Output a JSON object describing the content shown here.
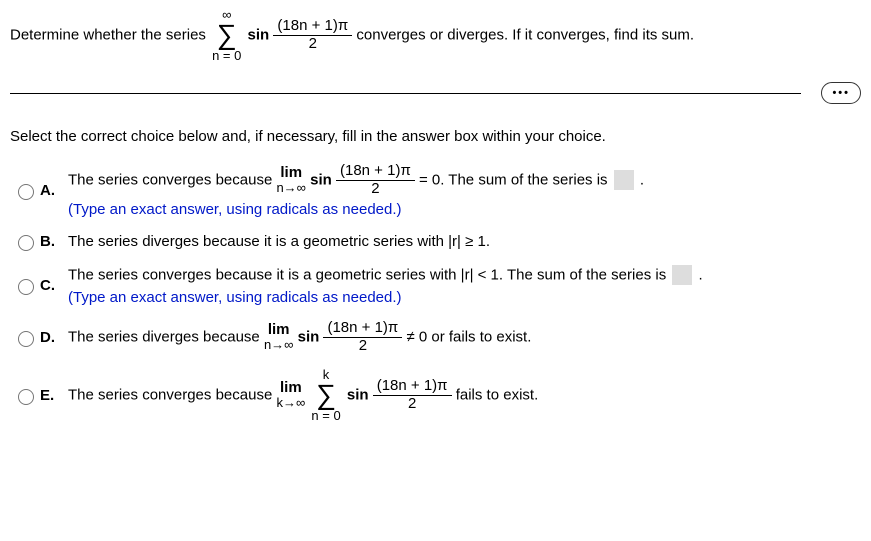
{
  "question": {
    "part1": "Determine whether the series ",
    "sigma_top": "∞",
    "sigma_bot": "n = 0",
    "func": "sin",
    "frac_num": "(18n + 1)π",
    "frac_den": "2",
    "part2": " converges or diverges. If it converges, find its sum."
  },
  "instr": "Select the correct choice below and, if necessary, fill in the answer box within your choice.",
  "more_label": "•••",
  "choices": {
    "A": {
      "label": "A.",
      "t1": "The series converges because  ",
      "lim_top": "lim",
      "lim_bot": "n→∞",
      "func": "sin",
      "frac_num": "(18n + 1)π",
      "frac_den": "2",
      "t2": " = 0. The sum of the series is ",
      "t3": ".",
      "hint": "(Type an exact answer, using radicals as needed.)"
    },
    "B": {
      "label": "B.",
      "text": "The series diverges because it is a geometric series with |r| ≥ 1."
    },
    "C": {
      "label": "C.",
      "t1": "The series converges because it is a geometric series with |r| < 1. The sum of the series is ",
      "t2": ".",
      "hint": "(Type an exact answer, using radicals as needed.)"
    },
    "D": {
      "label": "D.",
      "t1": "The series diverges because  ",
      "lim_top": "lim",
      "lim_bot": "n→∞",
      "func": "sin",
      "frac_num": "(18n + 1)π",
      "frac_den": "2",
      "t2": " ≠ 0 or fails to exist."
    },
    "E": {
      "label": "E.",
      "t1": "The series converges because  ",
      "lim_top": "lim",
      "lim_bot": "k→∞",
      "sigma_top": "k",
      "sigma_bot": "n = 0",
      "func": "sin",
      "frac_num": "(18n + 1)π",
      "frac_den": "2",
      "t2": " fails to exist."
    }
  }
}
